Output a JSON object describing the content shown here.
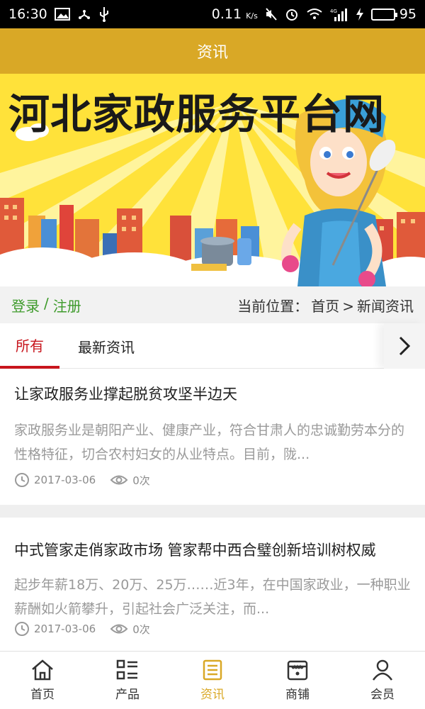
{
  "status_bar": {
    "time": "16:30",
    "net_speed": "0.11",
    "net_unit": "K/s",
    "signal_label": "4G",
    "battery": "95",
    "battery_level": 0.95
  },
  "header": {
    "title": "资讯"
  },
  "banner": {
    "title": "河北家政服务平台网"
  },
  "location_bar": {
    "login": "登录",
    "slash": "/",
    "register": "注册",
    "location_prefix": "当前位置：",
    "home": "首页",
    "arrow": ">",
    "current": "新闻资讯"
  },
  "tabs": [
    {
      "label": "所有",
      "active": true
    },
    {
      "label": "最新资讯",
      "active": false
    }
  ],
  "news": [
    {
      "title": "让家政服务业撑起脱贫攻坚半边天",
      "summary": "家政服务业是朝阳产业、健康产业，符合甘肃人的忠诚勤劳本分的性格特征，切合农村妇女的从业特点。目前，陇...",
      "date": "2017-03-06",
      "views": "0次"
    },
    {
      "title": "中式管家走俏家政市场 管家帮中西合璧创新培训树权威",
      "summary": "起步年薪18万、20万、25万……近3年，在中国家政业，一种职业薪酬如火箭攀升，引起社会广泛关注，而...",
      "date": "2017-03-06",
      "views": "0次"
    }
  ],
  "bottom_nav": [
    {
      "label": "首页",
      "icon": "home-icon",
      "active": false
    },
    {
      "label": "产品",
      "icon": "list-icon",
      "active": false
    },
    {
      "label": "资讯",
      "icon": "news-icon",
      "active": true
    },
    {
      "label": "商铺",
      "icon": "shop-icon",
      "active": false
    },
    {
      "label": "会员",
      "icon": "user-icon",
      "active": false
    }
  ],
  "colors": {
    "header": "#d9a826",
    "accent_red": "#c8161d",
    "login_green": "#3d9a2a",
    "nav_active": "#d9a826"
  }
}
